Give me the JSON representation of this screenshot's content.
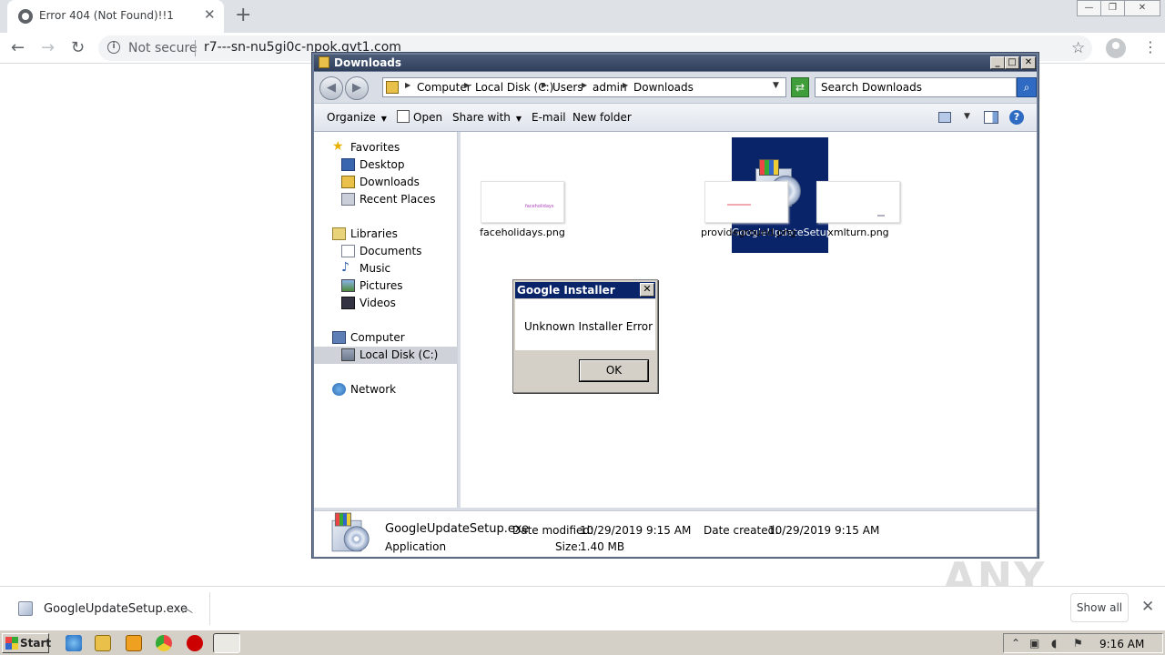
{
  "browser": {
    "tab_title": "Error 404 (Not Found)!!1",
    "security_label": "Not secure",
    "url": "r7---sn-nu5gi0c-npok.gvt1.com"
  },
  "explorer": {
    "title": "Downloads",
    "breadcrumb": [
      "Computer",
      "Local Disk (C:)",
      "Users",
      "admin",
      "Downloads"
    ],
    "search_placeholder": "Search Downloads",
    "commands": {
      "organize": "Organize",
      "open": "Open",
      "share_with": "Share with",
      "email": "E-mail",
      "new_folder": "New folder"
    },
    "nav": {
      "favorites": "Favorites",
      "desktop": "Desktop",
      "downloads": "Downloads",
      "recent_places": "Recent Places",
      "libraries": "Libraries",
      "documents": "Documents",
      "music": "Music",
      "pictures": "Pictures",
      "videos": "Videos",
      "computer": "Computer",
      "local_disk": "Local Disk (C:)",
      "network": "Network"
    },
    "files": [
      {
        "name": "faceholidays.png",
        "thumb_text": "faceholidays"
      },
      {
        "name": "GoogleUpdateSetup.exe"
      },
      {
        "name": "provideground.png"
      },
      {
        "name": "xmlturn.png"
      }
    ],
    "details": {
      "filename": "GoogleUpdateSetup.exe",
      "date_modified_label": "Date modified:",
      "date_modified": "10/29/2019 9:15 AM",
      "date_created_label": "Date created:",
      "date_created": "10/29/2019 9:15 AM",
      "type": "Application",
      "size_label": "Size:",
      "size": "1.40 MB"
    }
  },
  "dialog": {
    "title": "Google Installer",
    "message": "Unknown Installer Error",
    "ok_label": "OK"
  },
  "download_shelf": {
    "filename": "GoogleUpdateSetup.exe",
    "show_all": "Show all"
  },
  "watermark": "ANY RUN",
  "taskbar": {
    "start_label": "Start",
    "clock": "9:16 AM"
  },
  "colors": {
    "selection": "#0a246a",
    "titlebar": "#2f3f5c",
    "taskbar": "#d4d0c8"
  }
}
